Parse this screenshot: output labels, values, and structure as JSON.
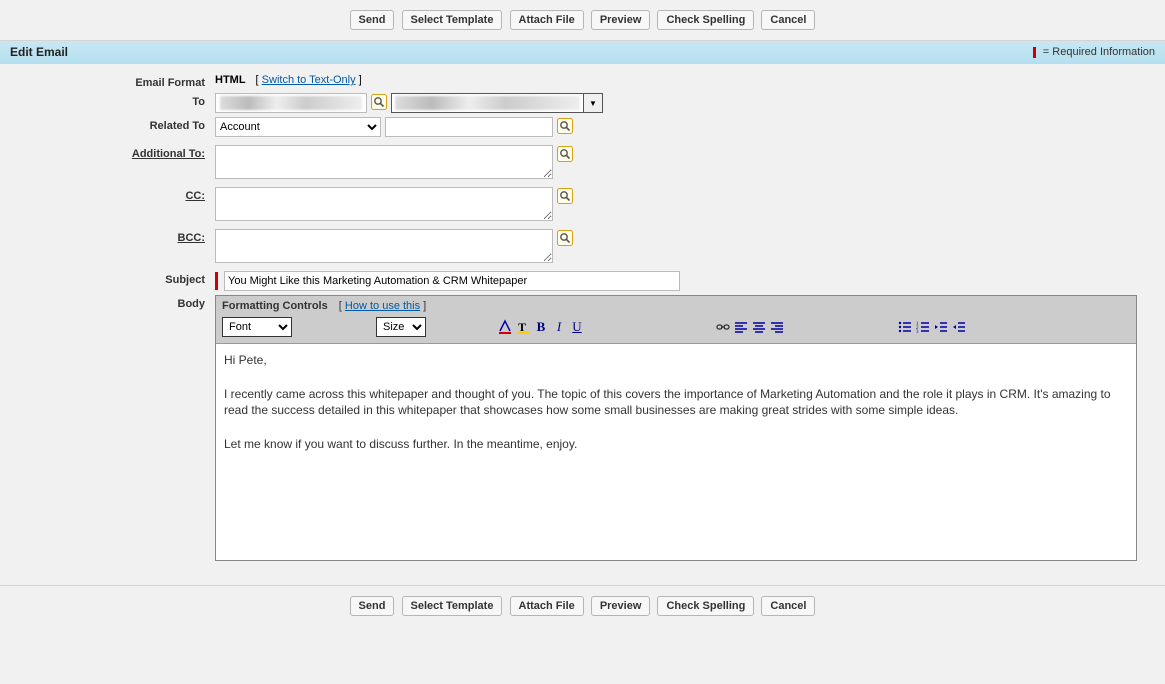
{
  "buttons": {
    "send": "Send",
    "select_template": "Select Template",
    "attach_file": "Attach File",
    "preview": "Preview",
    "check_spelling": "Check Spelling",
    "cancel": "Cancel"
  },
  "header": {
    "title": "Edit Email",
    "required_info": "= Required Information"
  },
  "labels": {
    "email_format": "Email Format",
    "to": "To",
    "related_to": "Related To",
    "additional_to": "Additional To:",
    "cc": "CC:",
    "bcc": "BCC:",
    "subject": "Subject",
    "body": "Body"
  },
  "format": {
    "current": "HTML",
    "switch_link": "Switch to Text-Only"
  },
  "related_to": {
    "selected": "Account",
    "value": ""
  },
  "recipients": {
    "additional_to": "",
    "cc": "",
    "bcc": ""
  },
  "subject": "You Might Like this Marketing Automation & CRM Whitepaper",
  "editor": {
    "formatting_controls": "Formatting Controls",
    "how_to_use": "How to use this",
    "font_label": "Font",
    "size_label": "Size"
  },
  "body_content": "Hi Pete,\n\nI recently came across this whitepaper and thought of you. The topic of this covers the importance of Marketing Automation and the role it plays in CRM. It's amazing to read the success detailed in this whitepaper that showcases how some small businesses are making great strides with some simple ideas.\n\nLet me know if you want to discuss further. In the meantime, enjoy."
}
